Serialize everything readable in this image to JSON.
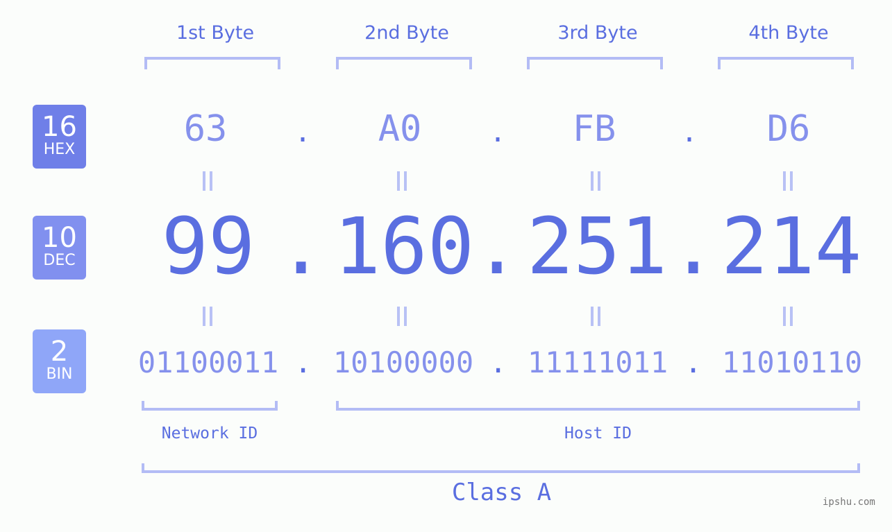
{
  "byte_headers": [
    "1st Byte",
    "2nd Byte",
    "3rd Byte",
    "4th Byte"
  ],
  "badges": {
    "hex": {
      "base": "16",
      "label": "HEX",
      "color": "#6f7fe8"
    },
    "dec": {
      "base": "10",
      "label": "DEC",
      "color": "#8190ef"
    },
    "bin": {
      "base": "2",
      "label": "BIN",
      "color": "#8fa6f8"
    }
  },
  "ip": {
    "hex": [
      "63",
      "A0",
      "FB",
      "D6"
    ],
    "dec": [
      "99",
      "160",
      "251",
      "214"
    ],
    "bin": [
      "01100011",
      "10100000",
      "11111011",
      "11010110"
    ],
    "separator": "."
  },
  "segments": {
    "network_id": "Network ID",
    "host_id": "Host ID"
  },
  "ip_class": "Class A",
  "watermark": "ipshu.com",
  "colors": {
    "accent": "#5a6ee0",
    "light_accent": "#8591ec",
    "bracket": "#b3bcf5",
    "background": "#fbfdfb"
  }
}
